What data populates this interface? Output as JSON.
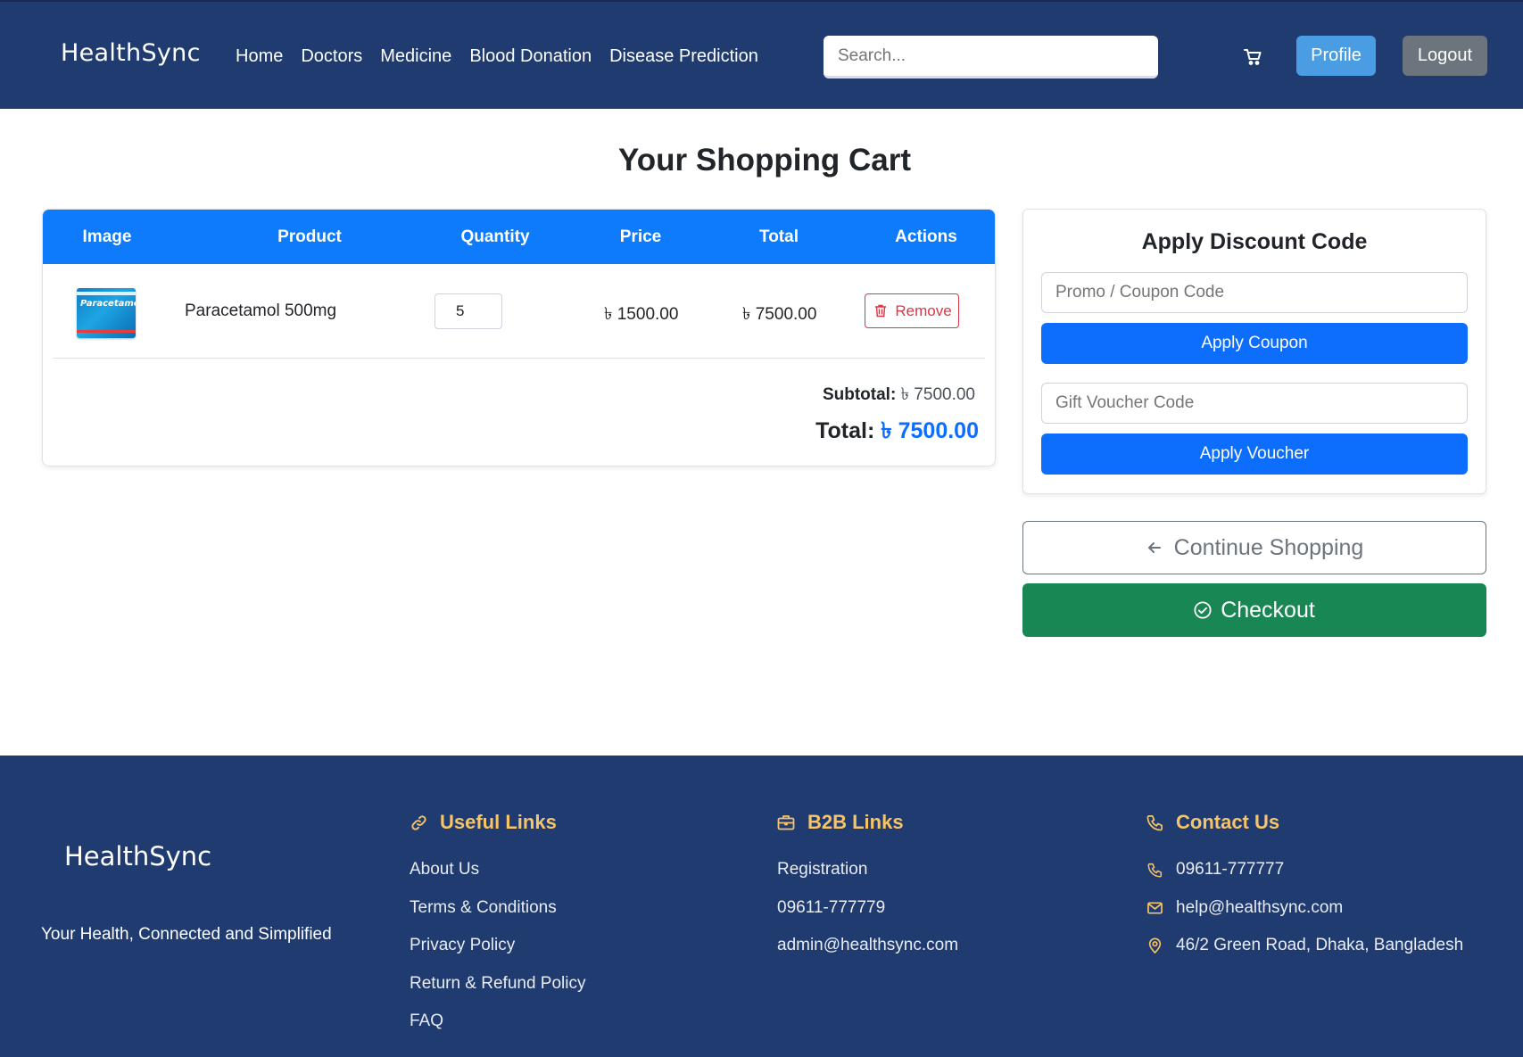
{
  "navbar": {
    "brand": "HealthSync",
    "links": [
      "Home",
      "Doctors",
      "Medicine",
      "Blood Donation",
      "Disease Prediction"
    ],
    "search_placeholder": "Search...",
    "cart_icon": "cart-icon",
    "profile_label": "Profile",
    "logout_label": "Logout"
  },
  "main": {
    "title": "Your Shopping Cart",
    "table": {
      "headers": [
        "Image",
        "Product",
        "Quantity",
        "Price",
        "Total",
        "Actions"
      ],
      "rows": [
        {
          "image_label": "Paracetamol",
          "product": "Paracetamol 500mg",
          "quantity": "5",
          "price": "৳ 1500.00",
          "total": "৳ 7500.00",
          "action": "Remove"
        }
      ]
    },
    "subtotal_label": "Subtotal:",
    "subtotal_value": "৳ 7500.00",
    "total_label": "Total:",
    "total_value": "৳ 7500.00"
  },
  "discount": {
    "title": "Apply Discount Code",
    "coupon_placeholder": "Promo / Coupon Code",
    "coupon_button": "Apply Coupon",
    "voucher_placeholder": "Gift Voucher Code",
    "voucher_button": "Apply Voucher"
  },
  "actions": {
    "continue_label": "Continue Shopping",
    "checkout_label": "Checkout"
  },
  "footer": {
    "brand": "HealthSync",
    "tagline": "Your Health, Connected and Simplified",
    "useful_links": {
      "title": "Useful Links",
      "items": [
        "About Us",
        "Terms & Conditions",
        "Privacy Policy",
        "Return & Refund Policy",
        "FAQ"
      ]
    },
    "b2b_links": {
      "title": "B2B Links",
      "items": [
        "Registration",
        "09611-777779",
        "admin@healthsync.com"
      ]
    },
    "contact": {
      "title": "Contact Us",
      "phone": "09611-777777",
      "email": "help@healthsync.com",
      "address": "46/2 Green Road, Dhaka, Bangladesh"
    }
  },
  "colors": {
    "navbar_bg": "#1f3b70",
    "primary": "#0d6efd",
    "table_header": "#0d7bfc",
    "success": "#198754",
    "danger": "#dc3545",
    "footer_heading": "#f7c46a"
  }
}
